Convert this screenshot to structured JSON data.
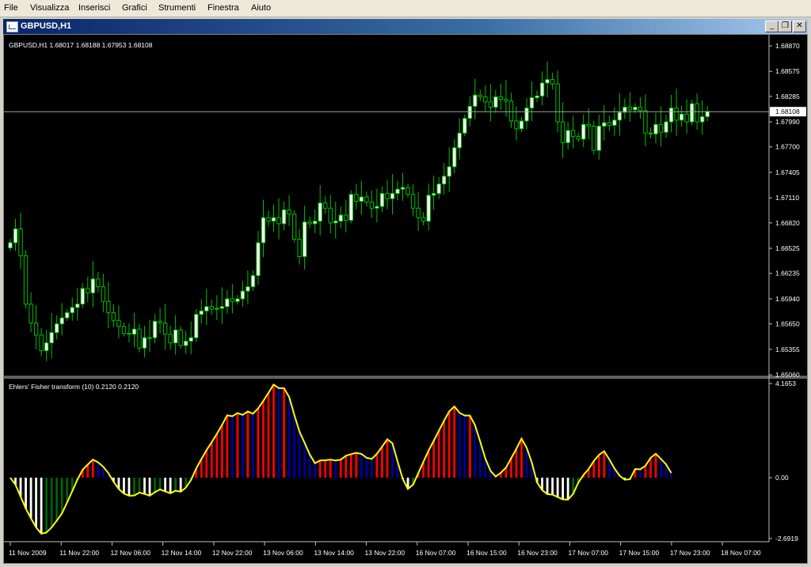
{
  "menu": [
    "File",
    "Visualizza",
    "Inserisci",
    "Grafici",
    "Strumenti",
    "Finestra",
    "Aiuto"
  ],
  "window": {
    "title": "GBPUSD,H1",
    "minimize_glyph": "_",
    "restore_glyph": "❐",
    "close_glyph": "✕"
  },
  "price_panel": {
    "info": "GBPUSD,H1  1.68017 1.68188 1.67953 1.68108",
    "current_price_label": "1.68108",
    "current_price": 1.68108
  },
  "indicator_panel": {
    "info": "Ehlers' Fisher transform (10) 0.2120 0.2120"
  },
  "colors": {
    "background": "#000000",
    "bull_candle": "#ffffff",
    "bear_candle": "#000000",
    "wick": "#00c000",
    "fisher_line": "#ffff00",
    "bar_up_strong": "#ff0000",
    "bar_up_weak": "#0000a0",
    "bar_down_strong": "#ffffff",
    "bar_down_weak": "#006400"
  },
  "chart_data": [
    {
      "type": "candlestick",
      "title": "GBPUSD,H1",
      "y_ticks": [
        "1.68870",
        "1.68575",
        "1.68285",
        "1.67990",
        "1.67700",
        "1.67405",
        "1.67110",
        "1.66820",
        "1.66525",
        "1.66235",
        "1.65940",
        "1.65650",
        "1.65355",
        "1.65060"
      ],
      "y_tick_values": [
        1.6887,
        1.68575,
        1.68285,
        1.6799,
        1.677,
        1.67405,
        1.6711,
        1.6682,
        1.66525,
        1.66235,
        1.6594,
        1.6565,
        1.65355,
        1.6506
      ],
      "ylim": [
        1.6506,
        1.6887
      ],
      "x_ticks": [
        "11 Nov 2009",
        "11 Nov 22:00",
        "12 Nov 06:00",
        "12 Nov 14:00",
        "12 Nov 22:00",
        "13 Nov 06:00",
        "13 Nov 14:00",
        "13 Nov 22:00",
        "16 Nov 07:00",
        "16 Nov 15:00",
        "16 Nov 23:00",
        "17 Nov 07:00",
        "17 Nov 15:00",
        "17 Nov 23:00",
        "18 Nov 07:00"
      ],
      "close": [
        1.6659,
        1.6675,
        1.6644,
        1.6588,
        1.6566,
        1.6552,
        1.6534,
        1.6543,
        1.6555,
        1.6565,
        1.6572,
        1.6578,
        1.6584,
        1.6588,
        1.6606,
        1.6601,
        1.6617,
        1.6608,
        1.6591,
        1.6578,
        1.6569,
        1.6562,
        1.6554,
        1.6553,
        1.6559,
        1.6537,
        1.6549,
        1.6549,
        1.6568,
        1.6566,
        1.6553,
        1.6543,
        1.6558,
        1.654,
        1.6545,
        1.6549,
        1.6576,
        1.658,
        1.6585,
        1.6582,
        1.6583,
        1.6585,
        1.6594,
        1.6591,
        1.6594,
        1.6603,
        1.6608,
        1.6621,
        1.6659,
        1.6688,
        1.6684,
        1.6688,
        1.6681,
        1.6697,
        1.6692,
        1.6663,
        1.6643,
        1.6683,
        1.6681,
        1.6684,
        1.6705,
        1.6699,
        1.6682,
        1.6684,
        1.6691,
        1.6685,
        1.6715,
        1.6707,
        1.6712,
        1.6706,
        1.6699,
        1.6701,
        1.6716,
        1.671,
        1.6716,
        1.6721,
        1.6723,
        1.6715,
        1.6699,
        1.6688,
        1.6684,
        1.6714,
        1.6716,
        1.6727,
        1.6736,
        1.6747,
        1.6769,
        1.6786,
        1.6803,
        1.6817,
        1.683,
        1.6828,
        1.6822,
        1.6816,
        1.6828,
        1.6825,
        1.6823,
        1.68,
        1.6791,
        1.68,
        1.6815,
        1.6827,
        1.6829,
        1.6844,
        1.6848,
        1.6843,
        1.6799,
        1.6775,
        1.6789,
        1.6782,
        1.6779,
        1.6796,
        1.6794,
        1.6766,
        1.6794,
        1.6798,
        1.6795,
        1.6801,
        1.681,
        1.6816,
        1.6813,
        1.6816,
        1.6812,
        1.6786,
        1.6785,
        1.6796,
        1.6787,
        1.6799,
        1.6815,
        1.6801,
        1.6808,
        1.6799,
        1.682,
        1.6799,
        1.6805,
        1.6811
      ]
    },
    {
      "type": "bar",
      "title": "Ehlers' Fisher transform (10) 0.2120 0.2120",
      "y_ticks": [
        "4.1653",
        "0.00",
        "-2.6919"
      ],
      "ylim": [
        -2.6919,
        4.1653
      ],
      "x_ticks": [
        "11 Nov 2009",
        "11 Nov 22:00",
        "12 Nov 06:00",
        "12 Nov 14:00",
        "12 Nov 22:00",
        "13 Nov 06:00",
        "13 Nov 14:00",
        "13 Nov 22:00",
        "16 Nov 07:00",
        "16 Nov 15:00",
        "16 Nov 23:00",
        "17 Nov 07:00",
        "17 Nov 15:00",
        "17 Nov 23:00",
        "18 Nov 07:00"
      ],
      "series": [
        {
          "name": "Ehlers' Fisher transform (10)",
          "values": [
            0,
            -0.31,
            -0.83,
            -1.37,
            -1.8,
            -2.2,
            -2.48,
            -2.43,
            -2.2,
            -1.9,
            -1.58,
            -1.1,
            -0.6,
            -0.08,
            0.35,
            0.58,
            0.8,
            0.68,
            0.48,
            0.2,
            -0.18,
            -0.5,
            -0.7,
            -0.8,
            -0.79,
            -0.66,
            -0.72,
            -0.8,
            -0.64,
            -0.52,
            -0.61,
            -0.69,
            -0.58,
            -0.62,
            -0.44,
            -0.1,
            0.4,
            0.82,
            1.22,
            1.57,
            1.94,
            2.33,
            2.76,
            2.72,
            2.86,
            2.78,
            2.93,
            2.83,
            3.07,
            3.4,
            3.76,
            4.12,
            3.96,
            3.96,
            3.57,
            2.78,
            2.04,
            1.54,
            1.02,
            0.64,
            0.76,
            0.77,
            0.8,
            0.76,
            0.8,
            0.97,
            1.04,
            1.1,
            1.05,
            0.88,
            0.83,
            1.06,
            1.37,
            1.7,
            1.52,
            0.72,
            -0.05,
            -0.5,
            -0.31,
            0.2,
            0.7,
            1.2,
            1.63,
            2.08,
            2.52,
            2.93,
            3.15,
            2.87,
            2.75,
            2.75,
            2.32,
            1.6,
            0.85,
            0.3,
            0.05,
            0.22,
            0.45,
            0.86,
            1.28,
            1.73,
            1.32,
            0.67,
            -0.2,
            -0.55,
            -0.73,
            -0.75,
            -0.86,
            -0.96,
            -0.97,
            -0.72,
            -0.22,
            0.12,
            0.38,
            0.74,
            1.01,
            1.17,
            0.81,
            0.41,
            0.09,
            -0.09,
            -0.07,
            0.38,
            0.37,
            0.53,
            0.88,
            1.06,
            0.83,
            0.59,
            0.21
          ]
        }
      ]
    }
  ]
}
